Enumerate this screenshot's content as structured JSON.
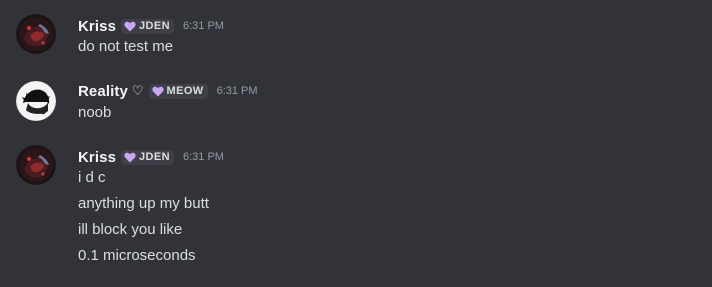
{
  "messages": [
    {
      "author": "Kriss",
      "author_suffix": "",
      "tag": "JDEN",
      "time": "6:31 PM",
      "lines": [
        "do not test me"
      ]
    },
    {
      "author": "Reality",
      "author_suffix": "♡",
      "tag": "MEOW",
      "time": "6:31 PM",
      "lines": [
        "noob"
      ]
    },
    {
      "author": "Kriss",
      "author_suffix": "",
      "tag": "JDEN",
      "time": "6:31 PM",
      "lines": [
        "i d c",
        "anything up my butt",
        "ill block you like",
        "0.1 microseconds"
      ]
    }
  ],
  "colors": {
    "background": "#313338",
    "username": "#f2f3f5",
    "message_text": "#dbdee1",
    "timestamp": "#949ba4",
    "tag_background": "#3f4047",
    "tag_heart": "#c9a7f5"
  },
  "icons": {
    "tag_icon": "heart-icon"
  }
}
